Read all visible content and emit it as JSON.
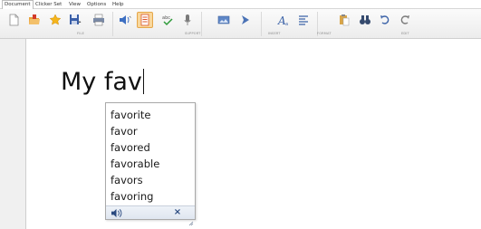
{
  "menu": {
    "tabs": [
      {
        "label": "Document",
        "active": true
      },
      {
        "label": "Clicker Set"
      },
      {
        "label": "View"
      },
      {
        "label": "Options"
      },
      {
        "label": "Help"
      }
    ]
  },
  "ribbon": {
    "groups": [
      {
        "label": "FILE"
      },
      {
        "label": "SUPPORT"
      },
      {
        "label": "INSERT"
      },
      {
        "label": "FORMAT"
      },
      {
        "label": "EDIT"
      }
    ],
    "buttons": [
      {
        "icon": "new-document-icon"
      },
      {
        "icon": "open-folder-icon"
      },
      {
        "icon": "favorite-star-icon"
      },
      {
        "icon": "save-icon"
      },
      {
        "icon": "print-icon"
      },
      {
        "icon": "speech-volume-icon"
      },
      {
        "icon": "word-prediction-icon",
        "active": true
      },
      {
        "icon": "spell-check-icon"
      },
      {
        "icon": "microphone-icon"
      },
      {
        "icon": "insert-picture-icon"
      },
      {
        "icon": "insert-arrow-icon"
      },
      {
        "icon": "font-icon"
      },
      {
        "icon": "align-icon"
      },
      {
        "icon": "paste-icon"
      },
      {
        "icon": "find-binoculars-icon"
      },
      {
        "icon": "undo-icon"
      },
      {
        "icon": "redo-icon"
      }
    ]
  },
  "document": {
    "text": "My fav"
  },
  "prediction": {
    "items": [
      "favorite",
      "favor",
      "favored",
      "favorable",
      "favors",
      "favoring"
    ],
    "close_label": "×"
  },
  "colors": {
    "active_button": "#f9d79c",
    "footer": "#dfe6f0"
  }
}
